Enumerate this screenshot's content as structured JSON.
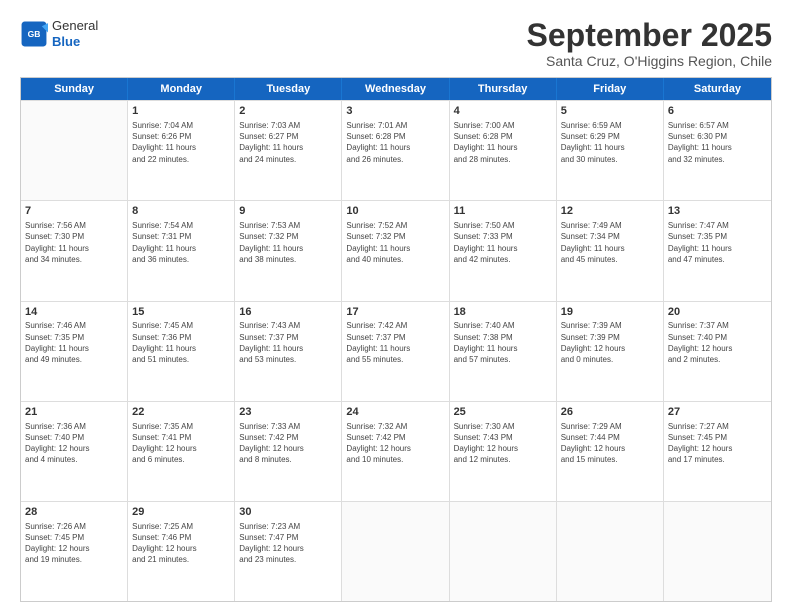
{
  "header": {
    "logo_line1": "General",
    "logo_line2": "Blue",
    "month": "September 2025",
    "location": "Santa Cruz, O'Higgins Region, Chile"
  },
  "days": [
    "Sunday",
    "Monday",
    "Tuesday",
    "Wednesday",
    "Thursday",
    "Friday",
    "Saturday"
  ],
  "rows": [
    [
      {
        "day": "",
        "info": ""
      },
      {
        "day": "1",
        "info": "Sunrise: 7:04 AM\nSunset: 6:26 PM\nDaylight: 11 hours\nand 22 minutes."
      },
      {
        "day": "2",
        "info": "Sunrise: 7:03 AM\nSunset: 6:27 PM\nDaylight: 11 hours\nand 24 minutes."
      },
      {
        "day": "3",
        "info": "Sunrise: 7:01 AM\nSunset: 6:28 PM\nDaylight: 11 hours\nand 26 minutes."
      },
      {
        "day": "4",
        "info": "Sunrise: 7:00 AM\nSunset: 6:28 PM\nDaylight: 11 hours\nand 28 minutes."
      },
      {
        "day": "5",
        "info": "Sunrise: 6:59 AM\nSunset: 6:29 PM\nDaylight: 11 hours\nand 30 minutes."
      },
      {
        "day": "6",
        "info": "Sunrise: 6:57 AM\nSunset: 6:30 PM\nDaylight: 11 hours\nand 32 minutes."
      }
    ],
    [
      {
        "day": "7",
        "info": "Sunrise: 7:56 AM\nSunset: 7:30 PM\nDaylight: 11 hours\nand 34 minutes."
      },
      {
        "day": "8",
        "info": "Sunrise: 7:54 AM\nSunset: 7:31 PM\nDaylight: 11 hours\nand 36 minutes."
      },
      {
        "day": "9",
        "info": "Sunrise: 7:53 AM\nSunset: 7:32 PM\nDaylight: 11 hours\nand 38 minutes."
      },
      {
        "day": "10",
        "info": "Sunrise: 7:52 AM\nSunset: 7:32 PM\nDaylight: 11 hours\nand 40 minutes."
      },
      {
        "day": "11",
        "info": "Sunrise: 7:50 AM\nSunset: 7:33 PM\nDaylight: 11 hours\nand 42 minutes."
      },
      {
        "day": "12",
        "info": "Sunrise: 7:49 AM\nSunset: 7:34 PM\nDaylight: 11 hours\nand 45 minutes."
      },
      {
        "day": "13",
        "info": "Sunrise: 7:47 AM\nSunset: 7:35 PM\nDaylight: 11 hours\nand 47 minutes."
      }
    ],
    [
      {
        "day": "14",
        "info": "Sunrise: 7:46 AM\nSunset: 7:35 PM\nDaylight: 11 hours\nand 49 minutes."
      },
      {
        "day": "15",
        "info": "Sunrise: 7:45 AM\nSunset: 7:36 PM\nDaylight: 11 hours\nand 51 minutes."
      },
      {
        "day": "16",
        "info": "Sunrise: 7:43 AM\nSunset: 7:37 PM\nDaylight: 11 hours\nand 53 minutes."
      },
      {
        "day": "17",
        "info": "Sunrise: 7:42 AM\nSunset: 7:37 PM\nDaylight: 11 hours\nand 55 minutes."
      },
      {
        "day": "18",
        "info": "Sunrise: 7:40 AM\nSunset: 7:38 PM\nDaylight: 11 hours\nand 57 minutes."
      },
      {
        "day": "19",
        "info": "Sunrise: 7:39 AM\nSunset: 7:39 PM\nDaylight: 12 hours\nand 0 minutes."
      },
      {
        "day": "20",
        "info": "Sunrise: 7:37 AM\nSunset: 7:40 PM\nDaylight: 12 hours\nand 2 minutes."
      }
    ],
    [
      {
        "day": "21",
        "info": "Sunrise: 7:36 AM\nSunset: 7:40 PM\nDaylight: 12 hours\nand 4 minutes."
      },
      {
        "day": "22",
        "info": "Sunrise: 7:35 AM\nSunset: 7:41 PM\nDaylight: 12 hours\nand 6 minutes."
      },
      {
        "day": "23",
        "info": "Sunrise: 7:33 AM\nSunset: 7:42 PM\nDaylight: 12 hours\nand 8 minutes."
      },
      {
        "day": "24",
        "info": "Sunrise: 7:32 AM\nSunset: 7:42 PM\nDaylight: 12 hours\nand 10 minutes."
      },
      {
        "day": "25",
        "info": "Sunrise: 7:30 AM\nSunset: 7:43 PM\nDaylight: 12 hours\nand 12 minutes."
      },
      {
        "day": "26",
        "info": "Sunrise: 7:29 AM\nSunset: 7:44 PM\nDaylight: 12 hours\nand 15 minutes."
      },
      {
        "day": "27",
        "info": "Sunrise: 7:27 AM\nSunset: 7:45 PM\nDaylight: 12 hours\nand 17 minutes."
      }
    ],
    [
      {
        "day": "28",
        "info": "Sunrise: 7:26 AM\nSunset: 7:45 PM\nDaylight: 12 hours\nand 19 minutes."
      },
      {
        "day": "29",
        "info": "Sunrise: 7:25 AM\nSunset: 7:46 PM\nDaylight: 12 hours\nand 21 minutes."
      },
      {
        "day": "30",
        "info": "Sunrise: 7:23 AM\nSunset: 7:47 PM\nDaylight: 12 hours\nand 23 minutes."
      },
      {
        "day": "",
        "info": ""
      },
      {
        "day": "",
        "info": ""
      },
      {
        "day": "",
        "info": ""
      },
      {
        "day": "",
        "info": ""
      }
    ]
  ]
}
